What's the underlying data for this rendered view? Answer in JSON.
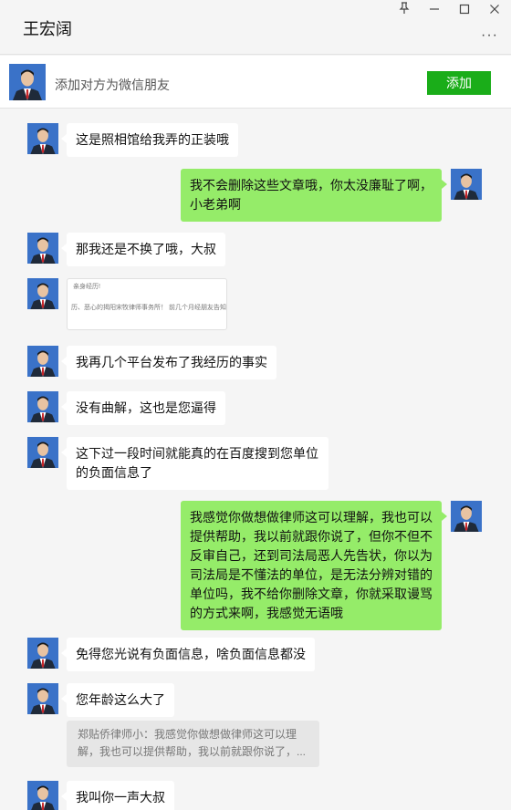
{
  "window": {
    "title": "王宏阔",
    "pin_icon": "pin-icon",
    "minimize_icon": "minimize-icon",
    "maximize_icon": "maximize-icon",
    "close_icon": "close-icon",
    "more_icon": "more-icon"
  },
  "add_friend": {
    "prompt": "添加对方为微信朋友",
    "button_label": "添加",
    "button_color": "#1aad19"
  },
  "colors": {
    "self_bubble": "#95ec69",
    "other_bubble": "#ffffff",
    "background": "#f5f5f5"
  },
  "messages": [
    {
      "side": "left",
      "text": "这是照相馆给我弄的正装哦"
    },
    {
      "side": "right",
      "text": "我不会删除这些文章哦，你太没廉耻了啊，小老弟啊"
    },
    {
      "side": "left",
      "text": "那我还是不换了哦，大叔"
    },
    {
      "side": "left",
      "type": "image",
      "image_lines": [
        "亲身经历!",
        "历、恶心的揭阳宋牧律师事务所！ 前几个月经朋友告知,"
      ]
    },
    {
      "side": "left",
      "text": "我再几个平台发布了我经历的事实"
    },
    {
      "side": "left",
      "text": "没有曲解，这也是您逼得"
    },
    {
      "side": "left",
      "text": "这下过一段时间就能真的在百度搜到您单位的负面信息了"
    },
    {
      "side": "right",
      "text": "我感觉你做想做律师这可以理解，我也可以提供帮助，我以前就跟你说了，但你不但不反审自己，还到司法局恶人先告状，你以为司法局是不懂法的单位，是无法分辨对错的单位吗，我不给你删除文章，你就采取谩骂的方式来啊，我感觉无语哦"
    },
    {
      "side": "left",
      "text": "免得您光说有负面信息，啥负面信息都没"
    },
    {
      "side": "left",
      "text": "您年龄这么大了",
      "quote": "郑贴侨律师小：我感觉你做想做律师这可以理解，我也可以提供帮助，我以前就跟你说了，..."
    },
    {
      "side": "left",
      "text": "我叫你一声大叔"
    }
  ]
}
